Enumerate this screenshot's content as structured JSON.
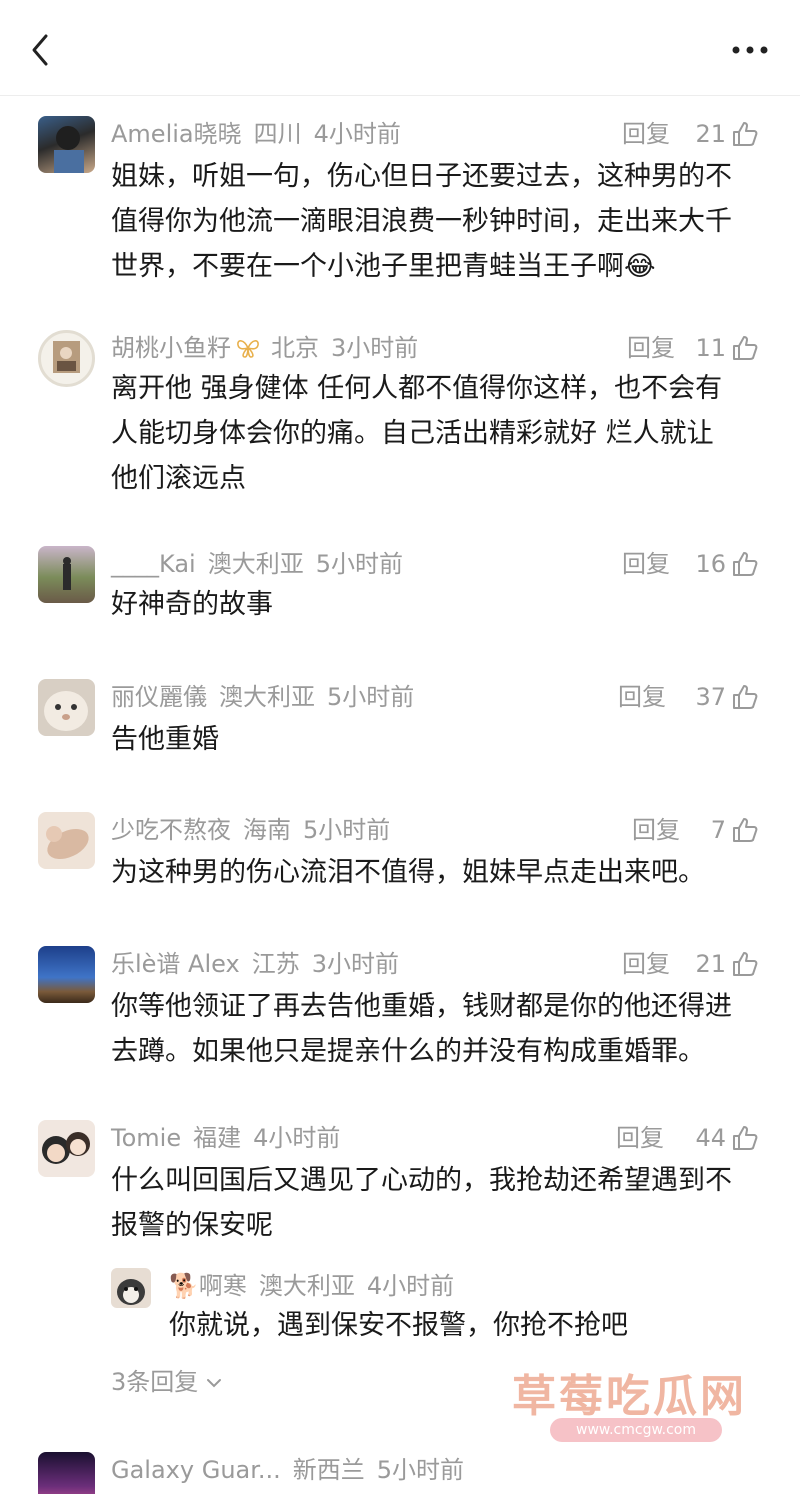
{
  "header": {
    "back_icon": "chevron-left-icon",
    "more_icon": "more-dots-icon"
  },
  "reply_label": "回复",
  "comments": [
    {
      "user": "Amelia晓晓",
      "location": "四川",
      "time": "4小时前",
      "likes": "21",
      "text_lines": [
        "姐妹，听姐一句，伤心但日子还要过去，这种男的不",
        "值得你为他流一滴眼泪浪费一秒钟时间，走出来大千",
        "世界，不要在一个小池子里把青蛙当王子啊😂"
      ]
    },
    {
      "user": "胡桃小鱼籽",
      "user_badge": "butterfly-badge-icon",
      "location": "北京",
      "time": "3小时前",
      "likes": "11",
      "text_lines": [
        "离开他 强身健体 任何人都不值得你这样，也不会有",
        "人能切身体会你的痛。自己活出精彩就好 烂人就让",
        "他们滚远点"
      ]
    },
    {
      "user": "____Kai",
      "location": "澳大利亚",
      "time": "5小时前",
      "likes": "16",
      "text_lines": [
        "好神奇的故事"
      ]
    },
    {
      "user": "丽仪麗儀",
      "location": "澳大利亚",
      "time": "5小时前",
      "likes": "37",
      "text_lines": [
        "告他重婚"
      ]
    },
    {
      "user": "少吃不熬夜",
      "location": "海南",
      "time": "5小时前",
      "likes": "7",
      "text_lines": [
        "为这种男的伤心流泪不值得，姐妹早点走出来吧。"
      ]
    },
    {
      "user": "乐lè谱 Alex",
      "location": "江苏",
      "time": "3小时前",
      "likes": "21",
      "text_lines": [
        "你等他领证了再去告他重婚，钱财都是你的他还得进",
        "去蹲。如果他只是提亲什么的并没有构成重婚罪。"
      ]
    },
    {
      "user": "Tomie",
      "location": "福建",
      "time": "4小时前",
      "likes": "44",
      "text_lines": [
        "什么叫回国后又遇见了心动的，我抢劫还希望遇到不",
        "报警的保安呢"
      ],
      "subreply": {
        "user": "🐕啊寒",
        "location": "澳大利亚",
        "time": "4小时前",
        "text": "你就说，遇到保安不报警，你抢不抢吧"
      },
      "more_replies": "3条回复"
    },
    {
      "user": "Galaxy Guar...",
      "location": "新西兰",
      "time": "5小时前"
    }
  ],
  "watermark": {
    "main": "草莓吃瓜网",
    "url": "www.cmcgw.com"
  },
  "colors": {
    "meta_gray": "#9a9a9a",
    "text": "#1a1a1a",
    "watermark": "#f0b6a2"
  }
}
